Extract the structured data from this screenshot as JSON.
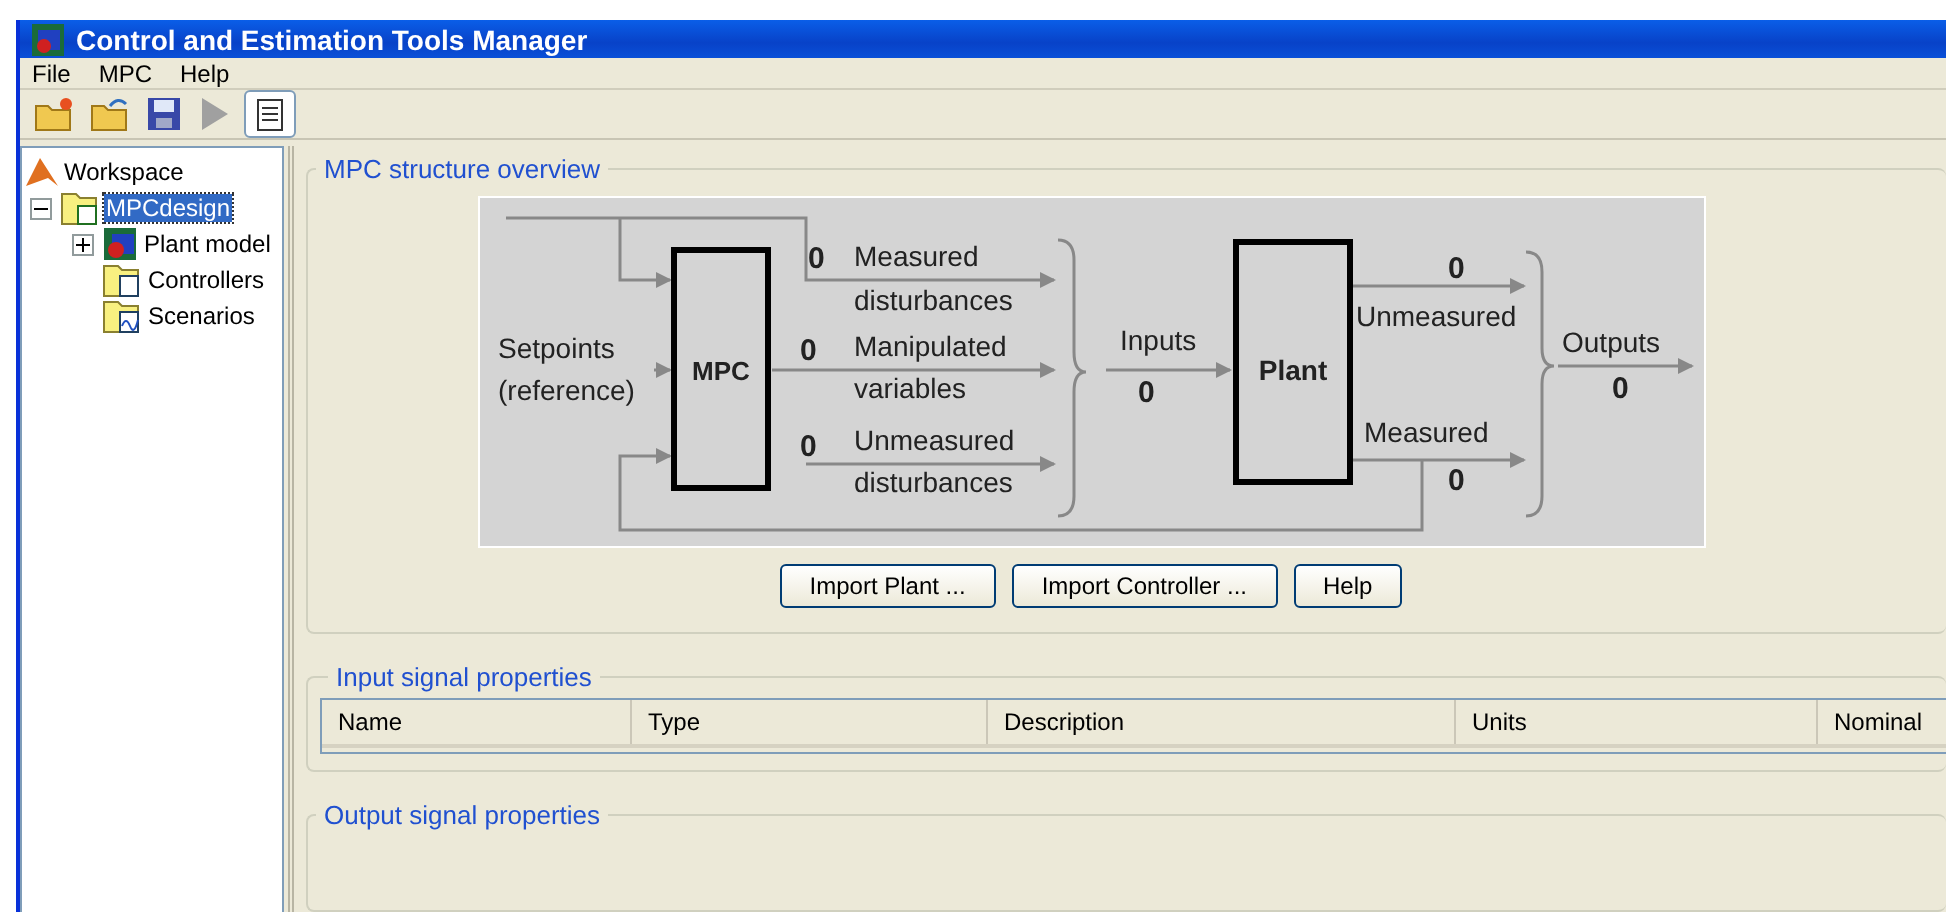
{
  "window": {
    "title": "Control and Estimation Tools Manager"
  },
  "menu": [
    "File",
    "MPC",
    "Help"
  ],
  "toolbar": [
    {
      "kind": "new",
      "disabled": false
    },
    {
      "kind": "open",
      "disabled": false
    },
    {
      "kind": "save",
      "disabled": false
    },
    {
      "kind": "run",
      "disabled": true
    },
    {
      "kind": "notes",
      "disabled": false
    }
  ],
  "tree": [
    {
      "label": "Workspace",
      "selected": false,
      "children": [
        {
          "label": "MPCdesign",
          "selected": true,
          "expanded": true,
          "children": [
            {
              "label": "Plant model",
              "kind": "plant",
              "selected": false,
              "expanded": false
            },
            {
              "label": "Controllers",
              "kind": "controllers",
              "selected": false
            },
            {
              "label": "Scenarios",
              "kind": "scenarios",
              "selected": false
            }
          ]
        }
      ]
    }
  ],
  "overview": {
    "title": "MPC structure overview",
    "diagram": {
      "setpoints": [
        "Setpoints",
        "(reference)"
      ],
      "controller": "MPC",
      "plant": "Plant",
      "measured_disturbances": {
        "count": "0",
        "label": [
          "Measured",
          "disturbances"
        ]
      },
      "manipulated_variables": {
        "count": "0",
        "label": [
          "Manipulated",
          "variables"
        ]
      },
      "unmeasured_disturbances": {
        "count": "0",
        "label": [
          "Unmeasured",
          "disturbances"
        ]
      },
      "inputs": {
        "label": "Inputs",
        "count": "0"
      },
      "unmeasured_outputs": {
        "label": "Unmeasured",
        "count": "0"
      },
      "measured_outputs": {
        "label": "Measured",
        "count": "0"
      },
      "outputs": {
        "label": "Outputs",
        "count": "0"
      }
    },
    "buttons": [
      "Import Plant ...",
      "Import Controller ...",
      "Help"
    ]
  },
  "input_signals": {
    "title": "Input signal properties",
    "columns": [
      "Name",
      "Type",
      "Description",
      "Units",
      "Nominal"
    ]
  },
  "output_signals": {
    "title": "Output signal properties"
  }
}
